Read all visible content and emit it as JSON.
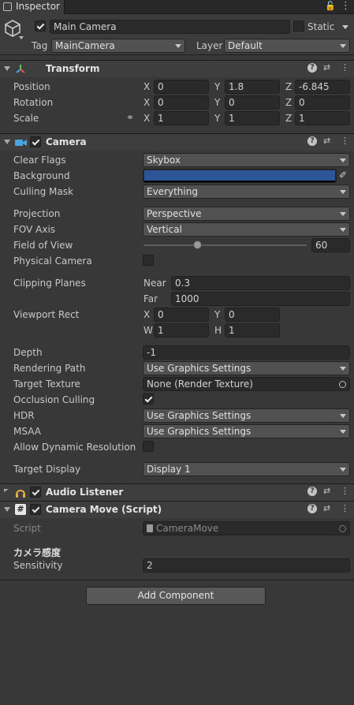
{
  "tab": {
    "title": "Inspector"
  },
  "gameobject": {
    "name": "Main Camera",
    "static_label": "Static",
    "tag_label": "Tag",
    "tag_value": "MainCamera",
    "layer_label": "Layer",
    "layer_value": "Default"
  },
  "transform": {
    "title": "Transform",
    "position": {
      "label": "Position",
      "x": "0",
      "y": "1.8",
      "z": "-6.845"
    },
    "rotation": {
      "label": "Rotation",
      "x": "0",
      "y": "0",
      "z": "0"
    },
    "scale": {
      "label": "Scale",
      "x": "1",
      "y": "1",
      "z": "1"
    },
    "axis_x": "X",
    "axis_y": "Y",
    "axis_z": "Z"
  },
  "camera": {
    "title": "Camera",
    "clear_flags": {
      "label": "Clear Flags",
      "value": "Skybox"
    },
    "background": {
      "label": "Background",
      "color": "#2b5596"
    },
    "culling_mask": {
      "label": "Culling Mask",
      "value": "Everything"
    },
    "projection": {
      "label": "Projection",
      "value": "Perspective"
    },
    "fov_axis": {
      "label": "FOV Axis",
      "value": "Vertical"
    },
    "field_of_view": {
      "label": "Field of View",
      "value": "60",
      "slider_fraction": 0.33
    },
    "physical_camera": {
      "label": "Physical Camera",
      "checked": false
    },
    "clipping": {
      "label": "Clipping Planes",
      "near_label": "Near",
      "near": "0.3",
      "far_label": "Far",
      "far": "1000"
    },
    "viewport": {
      "label": "Viewport Rect",
      "x_label": "X",
      "x": "0",
      "y_label": "Y",
      "y": "0",
      "w_label": "W",
      "w": "1",
      "h_label": "H",
      "h": "1"
    },
    "depth": {
      "label": "Depth",
      "value": "-1"
    },
    "rendering_path": {
      "label": "Rendering Path",
      "value": "Use Graphics Settings"
    },
    "target_texture": {
      "label": "Target Texture",
      "value": "None (Render Texture)"
    },
    "occlusion": {
      "label": "Occlusion Culling",
      "checked": true
    },
    "hdr": {
      "label": "HDR",
      "value": "Use Graphics Settings"
    },
    "msaa": {
      "label": "MSAA",
      "value": "Use Graphics Settings"
    },
    "dynamic_res": {
      "label": "Allow Dynamic Resolution",
      "checked": false
    },
    "target_display": {
      "label": "Target Display",
      "value": "Display 1"
    }
  },
  "audio_listener": {
    "title": "Audio Listener"
  },
  "camera_move": {
    "title": "Camera Move (Script)",
    "script_label": "Script",
    "script_value": "CameraMove",
    "section_header": "カメラ感度",
    "sensitivity_label": "Sensitivity",
    "sensitivity_value": "2"
  },
  "add_component": "Add Component",
  "colors": {
    "panel": "#383838",
    "header": "#3e3e3e",
    "field": "#2a2a2a",
    "dropdown": "#515151",
    "camera_icon": "#4aa3df",
    "audio_icon": "#e3b341"
  }
}
